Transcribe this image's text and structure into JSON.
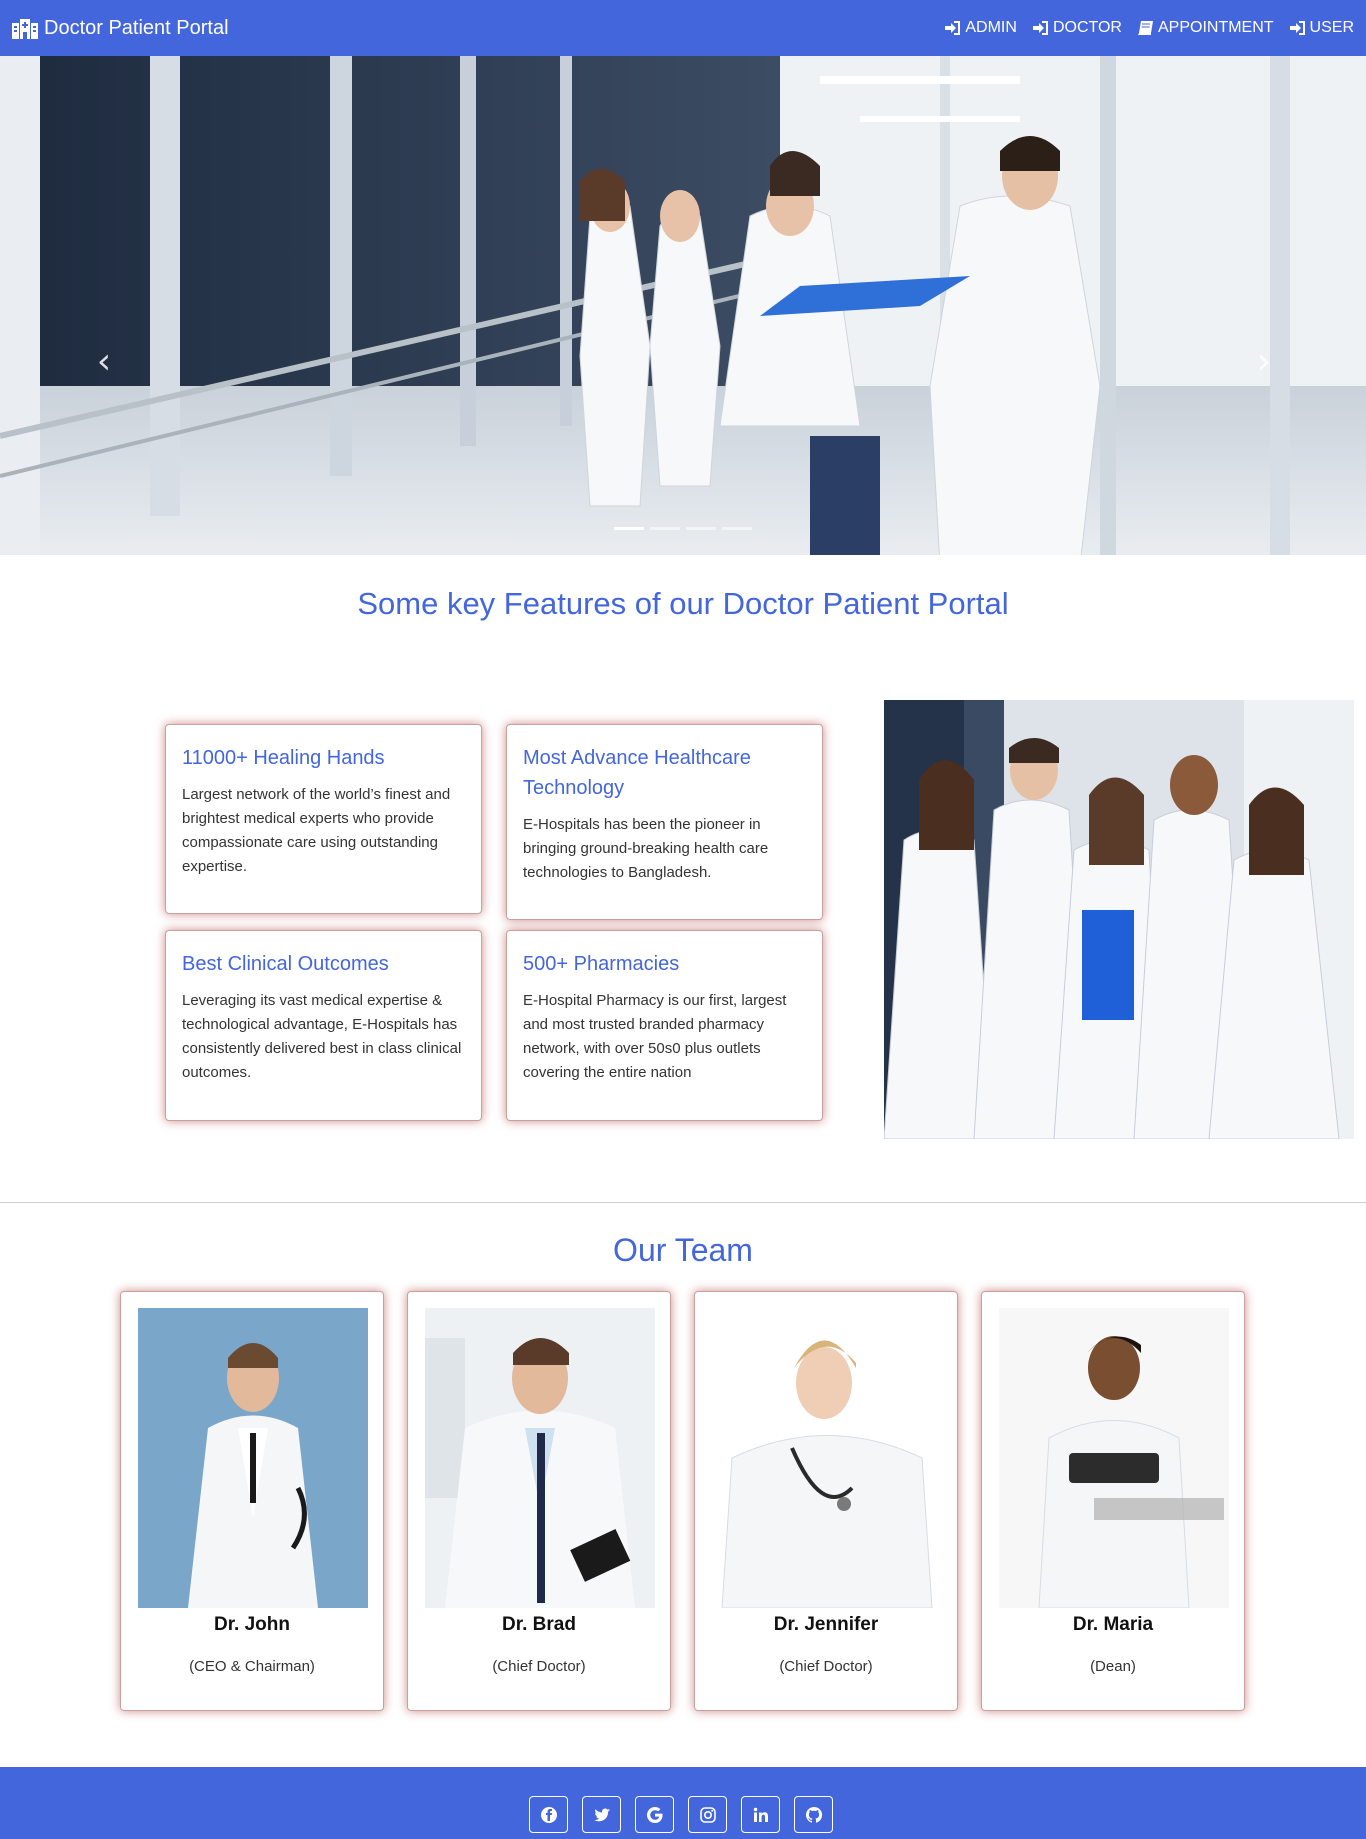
{
  "navbar": {
    "brand": "Doctor Patient Portal",
    "links": [
      {
        "label": "ADMIN"
      },
      {
        "label": "DOCTOR"
      },
      {
        "label": "APPOINTMENT"
      },
      {
        "label": "USER"
      }
    ]
  },
  "carousel": {
    "prev_icon": "chevron-left-icon",
    "next_icon": "chevron-right-icon",
    "slide_count": 4,
    "active_slide": 1
  },
  "features": {
    "title": "Some key Features of our Doctor Patient Portal",
    "cards": [
      {
        "title": "11000+ Healing Hands",
        "text": "Largest network of the world’s finest and brightest medical experts who provide compassionate care using outstanding expertise."
      },
      {
        "title": "Most Advance Healthcare Technology",
        "text": "E-Hospitals has been the pioneer in bringing ground-breaking health care technologies to Bangladesh."
      },
      {
        "title": "Best Clinical Outcomes",
        "text": "Leveraging its vast medical expertise & technological advantage, E-Hospitals has consistently delivered best in class clinical outcomes."
      },
      {
        "title": "500+ Pharmacies",
        "text": "E-Hospital Pharmacy is our first, largest and most trusted branded pharmacy network, with over 50s0 plus outlets covering the entire nation"
      }
    ]
  },
  "team": {
    "title": "Our Team",
    "members": [
      {
        "name": "Dr. John",
        "role": "(CEO & Chairman)"
      },
      {
        "name": "Dr. Brad",
        "role": "(Chief Doctor)"
      },
      {
        "name": "Dr. Jennifer",
        "role": "(Chief Doctor)"
      },
      {
        "name": "Dr. Maria",
        "role": "(Dean)"
      }
    ]
  },
  "footer": {
    "social": [
      "facebook-icon",
      "twitter-icon",
      "google-icon",
      "instagram-icon",
      "linkedin-icon",
      "github-icon"
    ]
  },
  "colors": {
    "primary": "#4466dd",
    "card_glow": "#aa2828"
  }
}
